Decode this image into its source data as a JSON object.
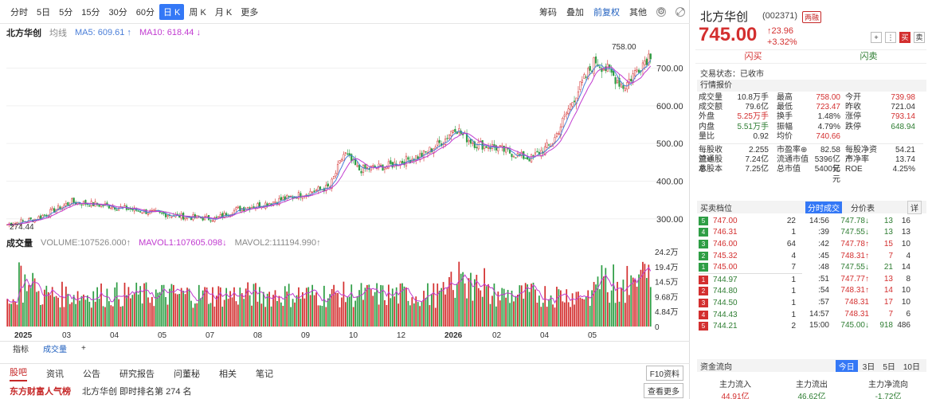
{
  "toolbar": {
    "periods": [
      "分时",
      "5日",
      "5分",
      "15分",
      "30分",
      "60分",
      "日 K",
      "周 K",
      "月 K",
      "更多"
    ],
    "right": [
      "筹码",
      "叠加",
      "前复权",
      "其他"
    ]
  },
  "legend": {
    "name": "北方华创",
    "line_type": "均线",
    "ma5": "MA5: 609.61 ↑",
    "ma10": "MA10: 618.44 ↓"
  },
  "price_axis": [
    "700.00",
    "600.00",
    "500.00",
    "400.00",
    "300.00"
  ],
  "annotations": {
    "high": "758.00",
    "low": "274.44"
  },
  "volume_legend": {
    "name": "成交量",
    "volume": "VOLUME:107526.000↑",
    "mavol1": "MAVOL1:107605.098↓",
    "mavol2": "MAVOL2:111194.990↑"
  },
  "volume_axis": [
    "24.2万",
    "19.4万",
    "14.5万",
    "9.68万",
    "4.84万",
    "0"
  ],
  "time_axis": [
    "2025",
    "03",
    "04",
    "05",
    "07",
    "08",
    "09",
    "10",
    "12",
    "2026",
    "02",
    "04",
    "05"
  ],
  "bottom_tabs": [
    "指标",
    "成交量",
    "+"
  ],
  "nav": [
    "股吧",
    "资讯",
    "公告",
    "研究报告",
    "问董秘",
    "相关",
    "笔记"
  ],
  "nav_f10": "F10资料",
  "rank": {
    "brand": "东方财富人气榜",
    "text": "北方华创  即时排名第 274 名",
    "more": "查看更多"
  },
  "stock": {
    "name": "北方华创",
    "code": "(002371)",
    "badge": "两融",
    "price": "745.00",
    "change": "↑23.96",
    "change_pct": "+3.32%",
    "btn_plus": "+",
    "btn_buy": "买",
    "btn_sell": "卖"
  },
  "flash": {
    "buy": "闪买",
    "sell": "闪卖"
  },
  "trade_status": "交易状态：已收市",
  "quote_title": "行情报价",
  "quote_rows": [
    [
      "成交量",
      "10.8万手",
      "最高",
      "758.00",
      "今开",
      "739.98"
    ],
    [
      "成交额",
      "79.6亿",
      "最低",
      "723.47",
      "昨收",
      "721.04"
    ],
    [
      "外盘",
      "5.25万手",
      "换手",
      "1.48%",
      "涨停",
      "793.14"
    ],
    [
      "内盘",
      "5.51万手",
      "振幅",
      "4.79%",
      "跌停",
      "648.94"
    ],
    [
      "量比",
      "0.92",
      "均价",
      "740.66",
      "",
      ""
    ]
  ],
  "fund_rows": [
    [
      "每股收益⊕",
      "2.255",
      "市盈率⊕",
      "82.58",
      "每股净资产",
      "54.21"
    ],
    [
      "流通股本",
      "7.24亿",
      "流通市值",
      "5396亿元",
      "市净率",
      "13.74"
    ],
    [
      "总股本",
      "7.25亿",
      "总市值",
      "5400亿元",
      "ROE",
      "4.25%"
    ]
  ],
  "orderbook_title": "买卖档位",
  "tick_tabs": [
    "分时成交",
    "分价表"
  ],
  "tick_more": "详",
  "sells": [
    [
      "5",
      "747.00",
      "22"
    ],
    [
      "4",
      "746.31",
      "1"
    ],
    [
      "3",
      "746.00",
      "64"
    ],
    [
      "2",
      "745.32",
      "4"
    ],
    [
      "1",
      "745.00",
      "7"
    ]
  ],
  "buys": [
    [
      "1",
      "744.97",
      "1"
    ],
    [
      "2",
      "744.80",
      "1"
    ],
    [
      "3",
      "744.50",
      "1"
    ],
    [
      "4",
      "744.43",
      "1"
    ],
    [
      "5",
      "744.21",
      "2"
    ]
  ],
  "ticks": [
    [
      "14:56",
      "747.78↓",
      "13",
      "16"
    ],
    [
      ":39",
      "747.55↓",
      "13",
      "13"
    ],
    [
      ":42",
      "747.78↑",
      "15",
      "10"
    ],
    [
      ":45",
      "748.31↑",
      "7",
      "4"
    ],
    [
      ":48",
      "747.55↓",
      "21",
      "14"
    ],
    [
      ":51",
      "747.77↑",
      "13",
      "8"
    ],
    [
      ":54",
      "748.31↑",
      "14",
      "10"
    ],
    [
      ":57",
      "748.31",
      "17",
      "10"
    ],
    [
      "14:57",
      "748.31",
      "7",
      "6"
    ],
    [
      "15:00",
      "745.00↓",
      "918",
      "486"
    ]
  ],
  "flow": {
    "title": "资金流向",
    "days": [
      "今日",
      "3日",
      "5日",
      "10日"
    ],
    "labels": [
      "主力流入",
      "主力流出",
      "主力净流向"
    ],
    "values": [
      "44.91亿",
      "46.62亿",
      "-1.72亿"
    ]
  }
}
